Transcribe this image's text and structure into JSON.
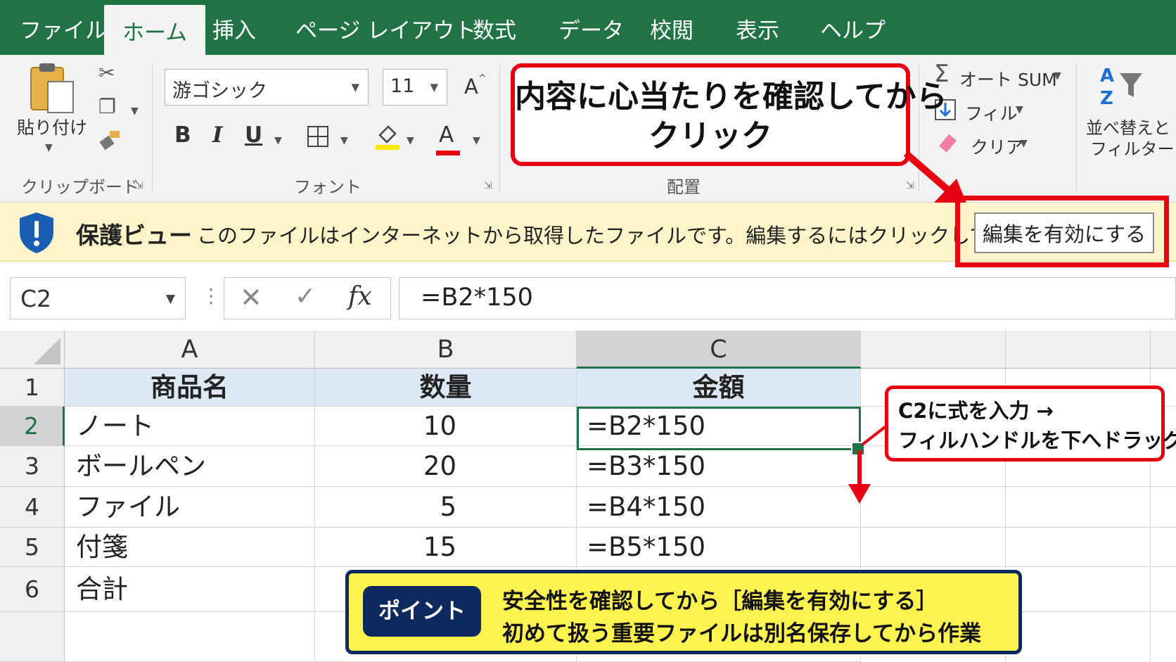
{
  "tabs": [
    "ファイル",
    "ホーム",
    "挿入",
    "ページ レイアウト",
    "数式",
    "データ",
    "校閲",
    "表示",
    "ヘルプ"
  ],
  "active_tab": "ホーム",
  "ribbon": {
    "clipboard": {
      "paste_label": "貼り付け",
      "group_label": "クリップボード"
    },
    "font": {
      "font_name": "游ゴシック",
      "font_size": "11",
      "bold": "B",
      "italic": "I",
      "underline": "U",
      "font_color_glyph": "A",
      "grow_glyph": "A",
      "group_label": "フォント"
    },
    "alignment": {
      "group_label": "配置"
    },
    "editing": {
      "autosum": "オート SUM",
      "fill": "フィル",
      "clear": "クリア",
      "sort_l1": "並べ替えと",
      "sort_l2": "フィルター"
    },
    "colors": {
      "accent": "#217346",
      "highlight": "#ffe600",
      "font_red": "#e60012"
    }
  },
  "callout_top": {
    "line1": "内容に心当たりを確認してから",
    "line2": "クリック"
  },
  "protected_view": {
    "title": "保護ビュー",
    "message": "このファイルはインターネットから取得したファイルです。編集するにはクリックしてください。",
    "button": "編集を有効にする"
  },
  "formula_bar": {
    "name_box": "C2",
    "formula": "=B2*150",
    "fx": "fx"
  },
  "sheet": {
    "columns": [
      "A",
      "B",
      "C"
    ],
    "rows": [
      "1",
      "2",
      "3",
      "4",
      "5",
      "6"
    ],
    "cells": [
      [
        "商品名",
        "数量",
        "金額"
      ],
      [
        "ノート",
        "10",
        "=B2*150"
      ],
      [
        "ボールペン",
        "20",
        "=B3*150"
      ],
      [
        "ファイル",
        "5",
        "=B4*150"
      ],
      [
        "付箋",
        "15",
        "=B5*150"
      ],
      [
        "合計",
        "",
        ""
      ]
    ],
    "active_cell": "C2"
  },
  "callout_right": {
    "line1": "C2に式を入力 →",
    "line2": "フィルハンドルを下へドラッグ"
  },
  "point": {
    "badge": "ポイント",
    "line1": "安全性を確認してから［編集を有効にする］",
    "line2": "初めて扱う重要ファイルは別名保存してから作業"
  }
}
